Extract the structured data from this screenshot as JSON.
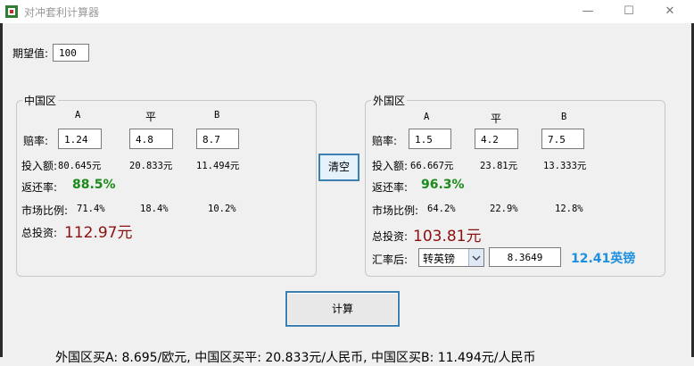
{
  "window": {
    "title": "对冲套利计算器",
    "minimize": "—",
    "maximize": "☐",
    "close": "✕"
  },
  "expect": {
    "label": "期望值:",
    "value": "100"
  },
  "china": {
    "group_label": "中国区",
    "col_a": "A",
    "col_p": "平",
    "col_b": "B",
    "odds_label": "赔率:",
    "odds_a": "1.24",
    "odds_p": "4.8",
    "odds_b": "8.7",
    "stake_label": "投入额:",
    "stake_a": "80.645元",
    "stake_p": "20.833元",
    "stake_b": "11.494元",
    "return_label": "返还率:",
    "return_value": "88.5%",
    "share_label": "市场比例:",
    "share_a": "71.4%",
    "share_p": "18.4%",
    "share_b": "10.2%",
    "total_label": "总投资:",
    "total_value": "112.97元"
  },
  "foreign": {
    "group_label": "外国区",
    "col_a": "A",
    "col_p": "平",
    "col_b": "B",
    "odds_label": "赔率:",
    "odds_a": "1.5",
    "odds_p": "4.2",
    "odds_b": "7.5",
    "stake_label": "投入额:",
    "stake_a": "66.667元",
    "stake_p": "23.81元",
    "stake_b": "13.333元",
    "return_label": "返还率:",
    "return_value": "96.3%",
    "share_label": "市场比例:",
    "share_a": "64.2%",
    "share_p": "22.9%",
    "share_b": "12.8%",
    "total_label": "总投资:",
    "total_value": "103.81元",
    "rate_label": "汇率后:",
    "currency_select": "转英镑",
    "rate_value": "8.3649",
    "converted": "12.41英镑"
  },
  "buttons": {
    "clear": "清空",
    "calculate": "计算"
  },
  "summary": "外国区买A: 8.695/欧元, 中国区买平: 20.833元/人民币, 中国区买B: 11.494元/人民币"
}
